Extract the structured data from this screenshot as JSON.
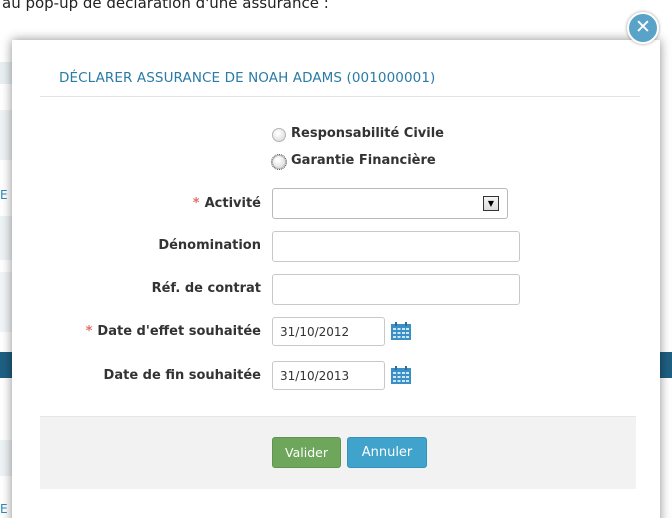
{
  "background": {
    "intro_text": "au pop-up de déclaration d'une assurance :",
    "side_letters": [
      "E",
      "E"
    ]
  },
  "modal": {
    "title": "DÉCLARER ASSURANCE DE NOAH ADAMS (001000001)",
    "close_symbol": "✕",
    "insurance_type": {
      "options": [
        "Responsabilité Civile",
        "Garantie Financière"
      ]
    },
    "fields": {
      "activite": {
        "label": "Activité",
        "required": true,
        "value": ""
      },
      "denomination": {
        "label": "Dénomination",
        "value": ""
      },
      "ref_contrat": {
        "label": "Réf. de contrat",
        "value": ""
      },
      "date_effet": {
        "label": "Date d'effet souhaitée",
        "required": true,
        "value": "31/10/2012"
      },
      "date_fin": {
        "label": "Date de fin souhaitée",
        "value": "31/10/2013"
      }
    },
    "required_mark": "*",
    "buttons": {
      "validate": "Valider",
      "cancel": "Annuler"
    }
  },
  "colors": {
    "title": "#2a7ba6",
    "accent_blue": "#3fa3cc",
    "validate_green": "#6ea75b",
    "required_star": "#e46d6d",
    "calendar_icon": "#3a8fc7"
  },
  "icons": [
    "close-icon",
    "dropdown-arrow-icon",
    "calendar-icon"
  ]
}
